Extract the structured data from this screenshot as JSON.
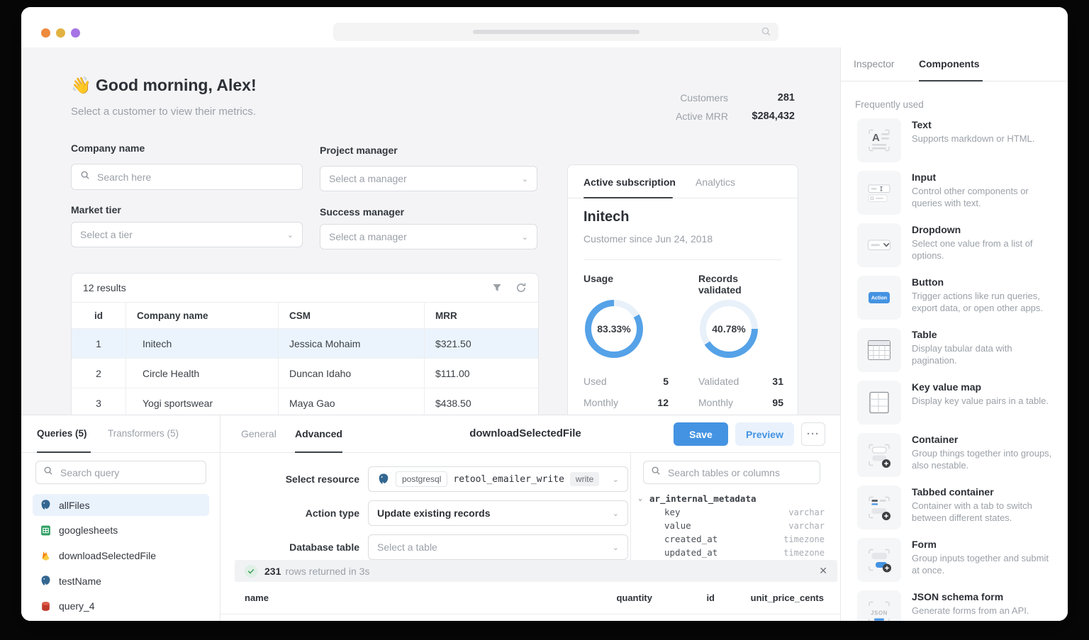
{
  "colors": {
    "accent": "#4493E2",
    "accent_soft": "#E9F2FC",
    "donut": "#55A2E8",
    "donut_track": "#E8F1FA",
    "selected_row": "#EBF4FC",
    "selected_item": "#EAF2FC",
    "green": "#43A05C",
    "green_soft": "#DFF0E6"
  },
  "window": {
    "traffic_lights": [
      "#EE8A3E",
      "#E2B341",
      "#A674E4"
    ]
  },
  "dashboard": {
    "greeting_emoji": "👋",
    "greeting": "Good morning, Alex!",
    "subtitle": "Select a customer to view their metrics.",
    "stats": [
      {
        "label": "Customers",
        "value": "281"
      },
      {
        "label": "Active MRR",
        "value": "$284,432"
      }
    ],
    "filters": {
      "company_label": "Company name",
      "company_placeholder": "Search here",
      "pm_label": "Project manager",
      "pm_value": "Select a manager",
      "tier_label": "Market tier",
      "tier_value": "Select a tier",
      "sm_label": "Success manager",
      "sm_value": "Select a manager"
    },
    "results_table": {
      "count_label": "12 results",
      "columns": [
        "id",
        "Company name",
        "CSM",
        "MRR"
      ],
      "rows": [
        {
          "id": "1",
          "company": "Initech",
          "csm": "Jessica Mohaim",
          "mrr": "$321.50",
          "selected": true
        },
        {
          "id": "2",
          "company": "Circle Health",
          "csm": "Duncan Idaho",
          "mrr": "$111.00",
          "selected": false
        },
        {
          "id": "3",
          "company": "Yogi sportswear",
          "csm": "Maya Gao",
          "mrr": "$438.50",
          "selected": false
        }
      ]
    },
    "customer_card": {
      "tab_active": "Active subscription",
      "tab_inactive": "Analytics",
      "name": "Initech",
      "since": "Customer since Jun 24, 2018",
      "metrics": [
        {
          "title": "Usage",
          "percent": 83.33,
          "percent_label": "83.33%",
          "arc_start": 60,
          "rows": [
            {
              "label": "Used",
              "value": "5"
            },
            {
              "label": "Monthly",
              "value": "12"
            }
          ]
        },
        {
          "title": "Records validated",
          "percent": 40.78,
          "percent_label": "40.78%",
          "arc_start": 90,
          "rows": [
            {
              "label": "Validated",
              "value": "31"
            },
            {
              "label": "Monthly",
              "value": "95"
            }
          ]
        }
      ]
    }
  },
  "components_panel": {
    "tab_inspector": "Inspector",
    "tab_components": "Components",
    "section": "Frequently used",
    "items": [
      {
        "icon": "text",
        "name": "Text",
        "desc": "Supports markdown or HTML."
      },
      {
        "icon": "input",
        "name": "Input",
        "desc": "Control other components or queries with text."
      },
      {
        "icon": "dropdown",
        "name": "Dropdown",
        "desc": "Select one value from a list of options."
      },
      {
        "icon": "button",
        "name": "Button",
        "desc": "Trigger actions like run queries, export data, or open other apps."
      },
      {
        "icon": "table",
        "name": "Table",
        "desc": "Display tabular data with pagination."
      },
      {
        "icon": "kv",
        "name": "Key value map",
        "desc": "Display key value pairs in a table."
      },
      {
        "icon": "container",
        "name": "Container",
        "desc": "Group things together into groups, also nestable."
      },
      {
        "icon": "tabbed",
        "name": "Tabbed container",
        "desc": "Container with a tab to switch between different states."
      },
      {
        "icon": "form",
        "name": "Form",
        "desc": "Group inputs together and submit at once."
      },
      {
        "icon": "json",
        "name": "JSON schema form",
        "desc": "Generate forms from an API."
      }
    ]
  },
  "query_panel": {
    "tab_queries": "Queries (5)",
    "tab_transformers": "Transformers (5)",
    "search_placeholder": "Search query",
    "queries": [
      {
        "icon": "postgres",
        "name": "allFiles",
        "selected": true
      },
      {
        "icon": "sheets",
        "name": "googlesheets",
        "selected": false
      },
      {
        "icon": "firebase",
        "name": "downloadSelectedFile",
        "selected": false
      },
      {
        "icon": "postgres",
        "name": "testName",
        "selected": false
      },
      {
        "icon": "reddb",
        "name": "query_4",
        "selected": false
      }
    ]
  },
  "query_editor": {
    "tab_general": "General",
    "tab_advanced": "Advanced",
    "title": "downloadSelectedFile",
    "save_label": "Save",
    "preview_label": "Preview",
    "more_label": "···",
    "fields": {
      "resource_label": "Select resource",
      "resource_badge": "postgresql",
      "resource_value": "retool_emailer_write",
      "resource_tag": "write",
      "action_label": "Action type",
      "action_value": "Update existing records",
      "table_label": "Database table",
      "table_placeholder": "Select a table"
    },
    "schema": {
      "search_placeholder": "Search tables or columns",
      "table": "ar_internal_metadata",
      "fields": [
        {
          "name": "key",
          "type": "varchar"
        },
        {
          "name": "value",
          "type": "varchar"
        },
        {
          "name": "created_at",
          "type": "timezone"
        },
        {
          "name": "updated_at",
          "type": "timezone"
        }
      ]
    },
    "toast": {
      "count": "231",
      "message": "rows returned in 3s"
    },
    "results_columns": [
      "name",
      "quantity",
      "id",
      "unit_price_cents"
    ]
  }
}
